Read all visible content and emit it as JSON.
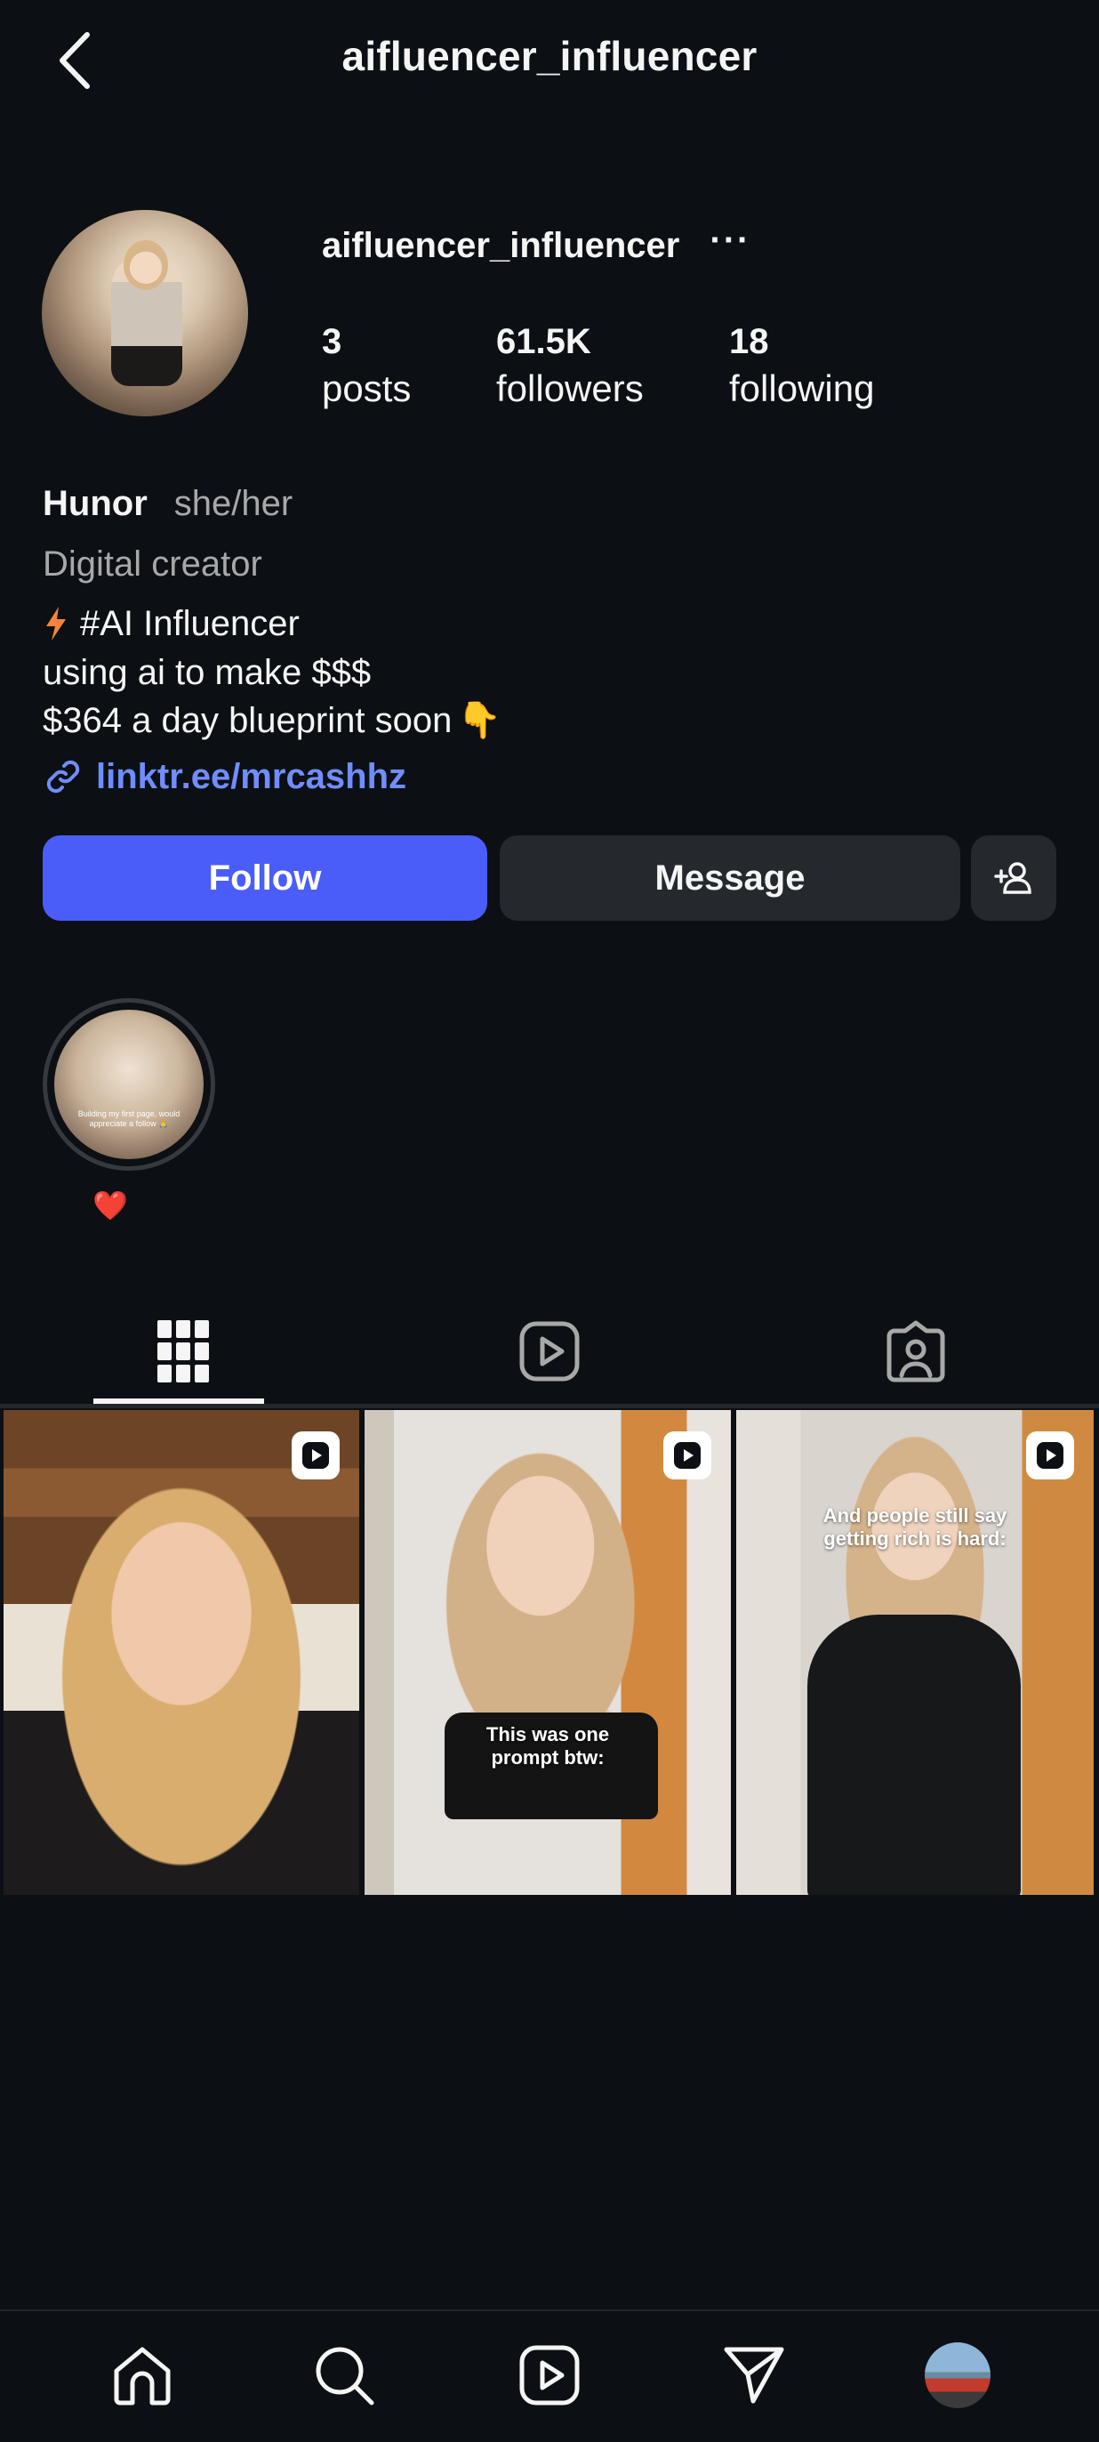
{
  "header": {
    "title": "aifluencer_influencer"
  },
  "profile": {
    "username": "aifluencer_influencer",
    "more": "···",
    "stats": {
      "posts": {
        "value": "3",
        "label": "posts"
      },
      "followers": {
        "value": "61.5K",
        "label": "followers"
      },
      "following": {
        "value": "18",
        "label": "following"
      }
    },
    "display_name": "Hunor",
    "pronouns": "she/her",
    "category": "Digital creator",
    "bio": {
      "line1_emoji": "⚡",
      "line1_text": "#AI Influencer",
      "line2": "using ai to make $$$",
      "line3_text": "$364 a day blueprint soon",
      "line3_emoji": "👇"
    },
    "link": "linktr.ee/mrcashhz"
  },
  "actions": {
    "follow": "Follow",
    "message": "Message"
  },
  "highlights": [
    {
      "label": "❤️",
      "cover_text": "Building my first page, would appreciate a follow 🙏"
    }
  ],
  "tabs": [
    {
      "name": "grid",
      "icon": "grid-icon",
      "active": true
    },
    {
      "name": "reels",
      "icon": "reels-icon",
      "active": false
    },
    {
      "name": "tagged",
      "icon": "tagged-icon",
      "active": false
    }
  ],
  "posts": [
    {
      "type": "reel",
      "overlay": ""
    },
    {
      "type": "reel",
      "overlay": "This was one prompt btw:"
    },
    {
      "type": "reel",
      "overlay": "And people still say getting rich is hard:"
    }
  ],
  "bottom_nav": [
    "home-icon",
    "search-icon",
    "reels-icon",
    "messages-icon",
    "profile-avatar"
  ],
  "colors": {
    "background": "#0c1014",
    "follow_button": "#4a5df9",
    "secondary_button": "#25292e",
    "link": "#708dff",
    "muted_text": "#a8a8a8"
  }
}
